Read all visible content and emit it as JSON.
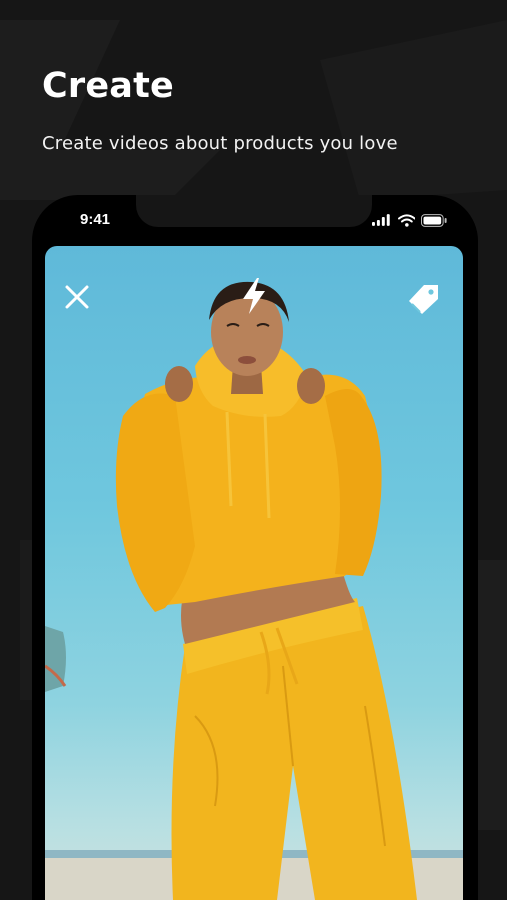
{
  "header": {
    "title": "Create",
    "subtitle": "Create videos about products you love"
  },
  "status_bar": {
    "time": "9:41",
    "icons": [
      "signal-icon",
      "wifi-icon",
      "battery-icon"
    ]
  },
  "camera": {
    "controls": [
      "close-icon",
      "flash-icon",
      "tag-icon"
    ]
  },
  "colors": {
    "background": "#161616",
    "text": "#ffffff",
    "sky": "#6fc7de",
    "outfit": "#f2b51e"
  }
}
